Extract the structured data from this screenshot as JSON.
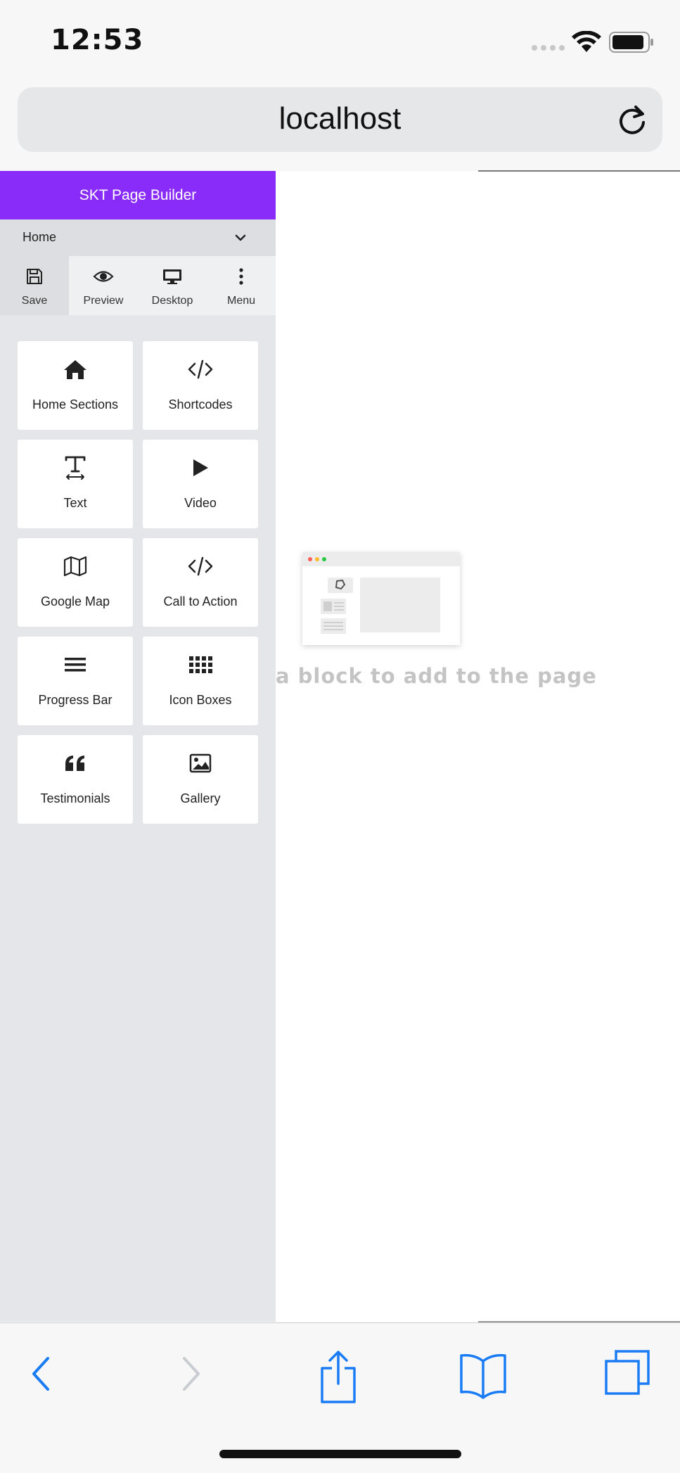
{
  "status_bar": {
    "time": "12:53"
  },
  "browser": {
    "url": "localhost"
  },
  "sidebar": {
    "header": "SKT Page Builder",
    "page_select": "Home",
    "toolbar": [
      {
        "label": "Save",
        "icon": "save-icon"
      },
      {
        "label": "Preview",
        "icon": "eye-icon"
      },
      {
        "label": "Desktop",
        "icon": "desktop-icon"
      },
      {
        "label": "Menu",
        "icon": "more-vertical-icon"
      }
    ],
    "blocks": [
      {
        "label": "Home Sections",
        "icon": "home-icon"
      },
      {
        "label": "Shortcodes",
        "icon": "code-icon"
      },
      {
        "label": "Text",
        "icon": "text-icon"
      },
      {
        "label": "Video",
        "icon": "play-icon"
      },
      {
        "label": "Google Map",
        "icon": "map-icon"
      },
      {
        "label": "Call to Action",
        "icon": "code-icon"
      },
      {
        "label": "Progress Bar",
        "icon": "bars-icon"
      },
      {
        "label": "Icon Boxes",
        "icon": "grid-icon"
      },
      {
        "label": "Testimonials",
        "icon": "quote-icon"
      },
      {
        "label": "Gallery",
        "icon": "image-icon"
      }
    ]
  },
  "canvas": {
    "empty_text": "a block to add to the page"
  },
  "colors": {
    "brand": "#8a2cf9",
    "ios_blue": "#1a7cf5"
  }
}
